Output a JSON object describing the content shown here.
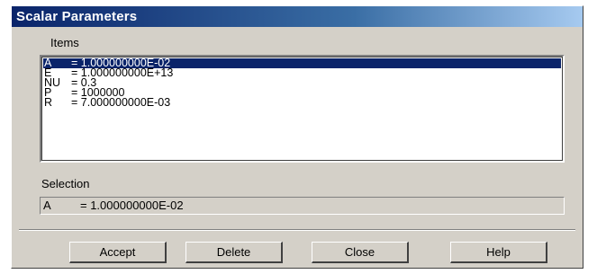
{
  "window": {
    "title": "Scalar Parameters"
  },
  "items": {
    "label": "Items",
    "rows": [
      {
        "name": "A",
        "value": "= 1.000000000E-02",
        "selected": true
      },
      {
        "name": "E",
        "value": "= 1.000000000E+13",
        "selected": false
      },
      {
        "name": "NU",
        "value": "= 0.3",
        "selected": false
      },
      {
        "name": "P",
        "value": "= 1000000",
        "selected": false
      },
      {
        "name": "R",
        "value": "= 7.000000000E-03",
        "selected": false
      }
    ]
  },
  "selection": {
    "label": "Selection",
    "name": "A",
    "value": "= 1.000000000E-02"
  },
  "buttons": {
    "accept": "Accept",
    "delete": "Delete",
    "close": "Close",
    "help": "Help"
  },
  "colors": {
    "title_bar": "#0a246a",
    "dialog_face": "#d4d0c8",
    "selection_highlight": "#0a246a"
  }
}
